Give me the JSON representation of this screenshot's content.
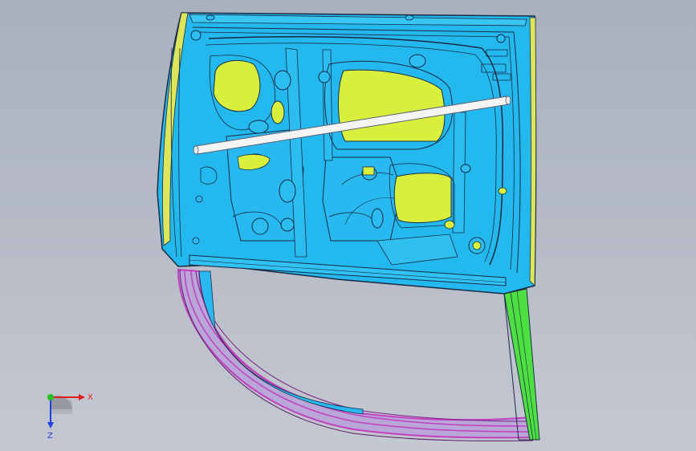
{
  "viewport": {
    "background_top": "#a9b0bd",
    "background_bottom": "#c4c8d1"
  },
  "model": {
    "panel_color": "#22b8ee",
    "edge_color": "#1b2a44",
    "pad_color": "#d8f03c",
    "flange_color": "#c23fbf",
    "strip_color": "#44dd3a",
    "rod_color": "#f4f4f4"
  },
  "triad": {
    "x_label": "X",
    "z_label": "Z",
    "x_color": "#e02020",
    "y_color": "#20c020",
    "z_color": "#2040e0"
  }
}
